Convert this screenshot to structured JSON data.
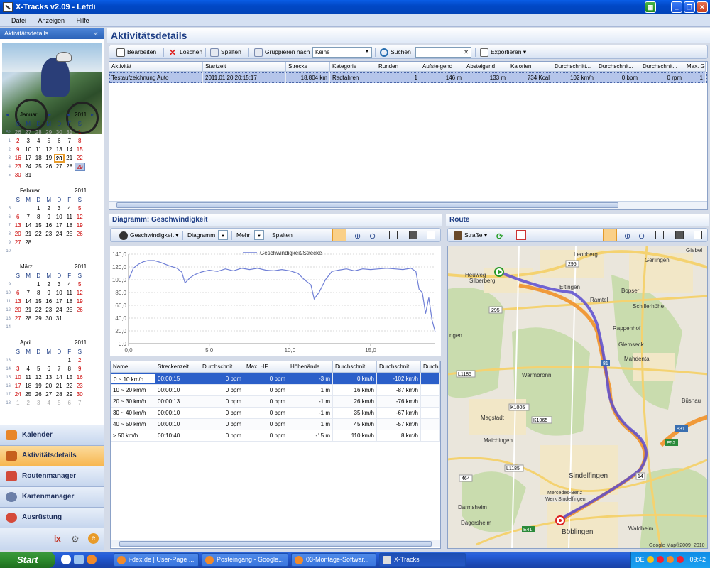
{
  "window": {
    "title": "X-Tracks v2.09 - Lefdi"
  },
  "menu": [
    "Datei",
    "Anzeigen",
    "Hilfe"
  ],
  "left": {
    "header": "Aktivitätsdetails",
    "collapse": "«",
    "calendar": {
      "weekday_headers": [
        "S",
        "M",
        "D",
        "M",
        "D",
        "F",
        "S"
      ],
      "months": [
        {
          "name": "Januar",
          "year": "2011",
          "show_nav": true,
          "weeks": [
            {
              "wk": "52",
              "days": [
                "26",
                "27",
                "28",
                "29",
                "30",
                "31",
                "1"
              ],
              "gray": [
                0,
                1,
                2,
                3,
                4,
                5
              ]
            },
            {
              "wk": "1",
              "days": [
                "2",
                "3",
                "4",
                "5",
                "6",
                "7",
                "8"
              ],
              "gray": []
            },
            {
              "wk": "2",
              "days": [
                "9",
                "10",
                "11",
                "12",
                "13",
                "14",
                "15"
              ],
              "gray": []
            },
            {
              "wk": "3",
              "days": [
                "16",
                "17",
                "18",
                "19",
                "20",
                "21",
                "22"
              ],
              "gray": [],
              "today": 4
            },
            {
              "wk": "4",
              "days": [
                "23",
                "24",
                "25",
                "26",
                "27",
                "28",
                "29"
              ],
              "gray": [],
              "sel": 6
            },
            {
              "wk": "5",
              "days": [
                "30",
                "31",
                "",
                "",
                "",
                "",
                ""
              ],
              "gray": []
            }
          ]
        },
        {
          "name": "Februar",
          "year": "2011",
          "weeks": [
            {
              "wk": "5",
              "days": [
                "",
                "",
                "1",
                "2",
                "3",
                "4",
                "5"
              ],
              "gray": []
            },
            {
              "wk": "6",
              "days": [
                "6",
                "7",
                "8",
                "9",
                "10",
                "11",
                "12"
              ],
              "gray": []
            },
            {
              "wk": "7",
              "days": [
                "13",
                "14",
                "15",
                "16",
                "17",
                "18",
                "19"
              ],
              "gray": []
            },
            {
              "wk": "8",
              "days": [
                "20",
                "21",
                "22",
                "23",
                "24",
                "25",
                "26"
              ],
              "gray": []
            },
            {
              "wk": "9",
              "days": [
                "27",
                "28",
                "",
                "",
                "",
                "",
                ""
              ],
              "gray": []
            },
            {
              "wk": "10",
              "days": [
                "",
                "",
                "",
                "",
                "",
                "",
                ""
              ],
              "gray": []
            }
          ]
        },
        {
          "name": "März",
          "year": "2011",
          "weeks": [
            {
              "wk": "9",
              "days": [
                "",
                "",
                "1",
                "2",
                "3",
                "4",
                "5"
              ],
              "gray": []
            },
            {
              "wk": "10",
              "days": [
                "6",
                "7",
                "8",
                "9",
                "10",
                "11",
                "12"
              ],
              "gray": []
            },
            {
              "wk": "11",
              "days": [
                "13",
                "14",
                "15",
                "16",
                "17",
                "18",
                "19"
              ],
              "gray": []
            },
            {
              "wk": "12",
              "days": [
                "20",
                "21",
                "22",
                "23",
                "24",
                "25",
                "26"
              ],
              "gray": []
            },
            {
              "wk": "13",
              "days": [
                "27",
                "28",
                "29",
                "30",
                "31",
                "",
                ""
              ],
              "gray": []
            },
            {
              "wk": "14",
              "days": [
                "",
                "",
                "",
                "",
                "",
                "",
                ""
              ],
              "gray": []
            }
          ]
        },
        {
          "name": "April",
          "year": "2011",
          "weeks": [
            {
              "wk": "13",
              "days": [
                "",
                "",
                "",
                "",
                "",
                "1",
                "2"
              ],
              "gray": []
            },
            {
              "wk": "14",
              "days": [
                "3",
                "4",
                "5",
                "6",
                "7",
                "8",
                "9"
              ],
              "gray": []
            },
            {
              "wk": "15",
              "days": [
                "10",
                "11",
                "12",
                "13",
                "14",
                "15",
                "16"
              ],
              "gray": []
            },
            {
              "wk": "16",
              "days": [
                "17",
                "18",
                "19",
                "20",
                "21",
                "22",
                "23"
              ],
              "gray": []
            },
            {
              "wk": "17",
              "days": [
                "24",
                "25",
                "26",
                "27",
                "28",
                "29",
                "30"
              ],
              "gray": []
            },
            {
              "wk": "18",
              "days": [
                "1",
                "2",
                "3",
                "4",
                "5",
                "6",
                "7"
              ],
              "gray": [
                0,
                1,
                2,
                3,
                4,
                5,
                6
              ]
            }
          ]
        }
      ]
    },
    "nav": [
      {
        "label": "Kalender",
        "color": "#e8862a"
      },
      {
        "label": "Aktivitätsdetails",
        "color": "#c65f1d",
        "active": true
      },
      {
        "label": "Routenmanager",
        "color": "#d24a3a"
      },
      {
        "label": "Kartenmanager",
        "color": "#6b7fa8"
      },
      {
        "label": "Ausrüstung",
        "color": "#d54a3a"
      }
    ]
  },
  "main": {
    "title": "Aktivitätsdetails",
    "toolbar": {
      "edit": "Bearbeiten",
      "delete": "Löschen",
      "columns": "Spalten",
      "group_by": "Gruppieren nach",
      "group_value": "Keine",
      "search": "Suchen",
      "search_value": "",
      "export": "Exportieren"
    },
    "activities": {
      "columns": [
        "Aktivität",
        "Startzeit",
        "Strecke",
        "Kategorie",
        "Runden",
        "Aufsteigend",
        "Absteigend",
        "Kalorien",
        "Durchschnitt...",
        "Durchschnit...",
        "Durchschnit...",
        "Max. Ge"
      ],
      "rows": [
        [
          "Testaufzeichnung Auto",
          "2011.01.20 20:15:17",
          "18,804 km",
          "Radfahren",
          "1",
          "146 m",
          "133 m",
          "734 Kcal",
          "102 km/h",
          "0 bpm",
          "0 rpm",
          "1"
        ]
      ]
    }
  },
  "diagram": {
    "title": "Diagramm:  Geschwindigkeit",
    "toolbar": {
      "metric": "Geschwindigkeit",
      "diagram": "Diagramm",
      "more": "Mehr",
      "columns": "Spalten"
    },
    "table": {
      "columns": [
        "Name",
        "Streckenzeit",
        "Durchschnit...",
        "Max. HF",
        "Höhenände...",
        "Durchschnit...",
        "Durchschnit...",
        "Durchs"
      ],
      "rows": [
        [
          "0 ~ 10 km/h",
          "00:00:15",
          "0 bpm",
          "0 bpm",
          "-3 m",
          "0 km/h",
          "-102 km/h",
          ""
        ],
        [
          "10 ~ 20 km/h",
          "00:00:10",
          "0 bpm",
          "0 bpm",
          "1 m",
          "16 km/h",
          "-87 km/h",
          ""
        ],
        [
          "20 ~ 30 km/h",
          "00:00:13",
          "0 bpm",
          "0 bpm",
          "-1 m",
          "26 km/h",
          "-76 km/h",
          ""
        ],
        [
          "30 ~ 40 km/h",
          "00:00:10",
          "0 bpm",
          "0 bpm",
          "-1 m",
          "35 km/h",
          "-67 km/h",
          ""
        ],
        [
          "40 ~ 50 km/h",
          "00:00:10",
          "0 bpm",
          "0 bpm",
          "1 m",
          "45 km/h",
          "-57 km/h",
          ""
        ],
        [
          "> 50 km/h",
          "00:10:40",
          "0 bpm",
          "0 bpm",
          "-15 m",
          "110 km/h",
          "8 km/h",
          ""
        ]
      ]
    }
  },
  "chart_data": {
    "type": "line",
    "title": "",
    "legend": "Geschwindigkeit/Strecke",
    "legend_placement": "top-center",
    "xlim": [
      0,
      19
    ],
    "ylim": [
      0,
      140
    ],
    "x_ticks": [
      "0,0",
      "5,0",
      "10,0",
      "15,0"
    ],
    "x_tick_values": [
      0,
      5,
      10,
      15
    ],
    "y_ticks": [
      "0,0",
      "20,0",
      "40,0",
      "60,0",
      "80,0",
      "100,0",
      "120,0",
      "140,0"
    ],
    "y_tick_values": [
      0,
      20,
      40,
      60,
      80,
      100,
      120,
      140
    ],
    "grid": true,
    "series": [
      {
        "name": "Geschwindigkeit/Strecke",
        "color": "#6f7fd6",
        "x": [
          0,
          0.3,
          0.6,
          0.9,
          1.2,
          1.6,
          2,
          2.5,
          3,
          3.3,
          3.5,
          3.8,
          4.1,
          4.5,
          5,
          5.5,
          6,
          6.5,
          7,
          7.5,
          8,
          8.5,
          9,
          9.5,
          10,
          10.5,
          10.9,
          11.3,
          11.5,
          11.8,
          12.2,
          12.6,
          13,
          13.5,
          14,
          14.5,
          15,
          15.5,
          16,
          16.5,
          17,
          17.5,
          17.8,
          18,
          18.2,
          18.4,
          18.6,
          18.8,
          19
        ],
        "y": [
          100,
          118,
          124,
          128,
          130,
          130,
          127,
          122,
          118,
          112,
          95,
          103,
          108,
          112,
          115,
          113,
          117,
          114,
          118,
          116,
          118,
          115,
          114,
          116,
          114,
          110,
          100,
          92,
          70,
          80,
          100,
          113,
          115,
          117,
          114,
          117,
          116,
          117,
          118,
          117,
          116,
          118,
          113,
          85,
          80,
          47,
          72,
          37,
          18
        ]
      }
    ]
  },
  "route": {
    "title": "Route",
    "toolbar": {
      "mode": "Straße"
    },
    "labels": [
      "Leonberg",
      "Gerlingen",
      "Giebel",
      "Heuweg",
      "Silberberg",
      "Eltingen",
      "Ramtel",
      "Bopser",
      "Schillerhöhe",
      "Rappenhof",
      "Glemseck",
      "Mahdental",
      "Warmbronn",
      "Büsnau",
      "Magstadt",
      "Maichingen",
      "Sindelfingen",
      "Mercedes-Benz Werk Sindelfingen",
      "Darmsheim",
      "Dagersheim",
      "Böblingen",
      "Waldheim",
      "295",
      "464",
      "L1185",
      "K1005",
      "K1065",
      "831",
      "E52",
      "E41",
      "81",
      "14"
    ],
    "copyright": "Google Map®2009~2010"
  },
  "taskbar": {
    "start": "Start",
    "items": [
      "i-dex.de | User-Page ...",
      "Posteingang - Google...",
      "03-Montage-Softwar...",
      "X-Tracks"
    ],
    "lang": "DE",
    "time": "09:42"
  }
}
